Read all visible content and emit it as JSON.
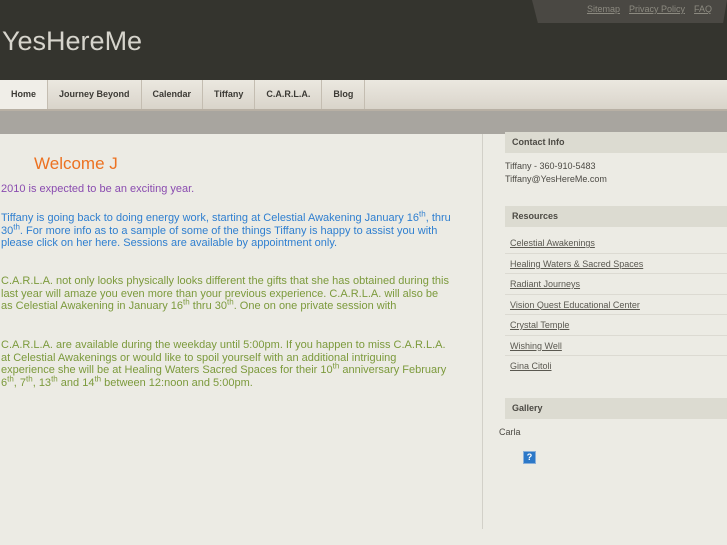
{
  "header": {
    "title": "YesHereMe",
    "links": [
      "Sitemap",
      "Privacy Policy",
      "FAQ"
    ]
  },
  "nav": [
    "Home",
    "Journey Beyond",
    "Calendar",
    "Tiffany",
    "C.A.R.L.A.",
    "Blog"
  ],
  "main": {
    "heading": "Welcome J",
    "paragraphs": [
      [
        {
          "t": "2010 is expected to be an exciting year."
        }
      ],
      [
        {
          "t": "Tiffany is going back to doing energy work, starting at Celestial Awakening January 16"
        },
        {
          "t": "th",
          "sup": true
        },
        {
          "t": ", thru 30"
        },
        {
          "t": "th",
          "sup": true
        },
        {
          "t": ".  For more info as to a sample of some of the things Tiffany is happy to assist you with please click on her here.  Sessions are available by appointment only."
        }
      ],
      [
        {
          "t": "C.A.R.L.A. not only looks physically looks different the gifts that she has obtained during this last year will amaze you even more than your previous experience. C.A.R.L.A. will also be as Celestial Awakening in January 16"
        },
        {
          "t": "th",
          "sup": true
        },
        {
          "t": " thru 30"
        },
        {
          "t": "th",
          "sup": true
        },
        {
          "t": ".   One on one private session with"
        }
      ],
      [
        {
          "t": "C.A.R.L.A. are available during the weekday until 5:00pm.  If you happen to miss C.A.R.L.A. at Celestial Awakenings or would like to spoil yourself with an additional intriguing experience she will be at Healing Waters Sacred Spaces for their 10"
        },
        {
          "t": "th",
          "sup": true
        },
        {
          "t": " anniversary February 6"
        },
        {
          "t": "th",
          "sup": true
        },
        {
          "t": ", 7"
        },
        {
          "t": "th",
          "sup": true
        },
        {
          "t": ", 13"
        },
        {
          "t": "th",
          "sup": true
        },
        {
          "t": " and 14"
        },
        {
          "t": "th",
          "sup": true
        },
        {
          "t": " between 12:noon and 5:00pm."
        }
      ]
    ]
  },
  "sidebar": {
    "contact": {
      "title": "Contact Info",
      "phone": "Tiffany - 360-910-5483",
      "email": "Tiffany@YesHereMe.com"
    },
    "resources": {
      "title": "Resources",
      "items": [
        "Celestial Awakenings",
        "Healing Waters & Sacred Spaces",
        "Radiant Journeys",
        "Vision Quest Educational Center",
        "Crystal Temple",
        "Wishing Well",
        "Gina Citoli"
      ]
    },
    "gallery": {
      "title": "Gallery",
      "caption": "Carla",
      "icon": "?"
    }
  }
}
